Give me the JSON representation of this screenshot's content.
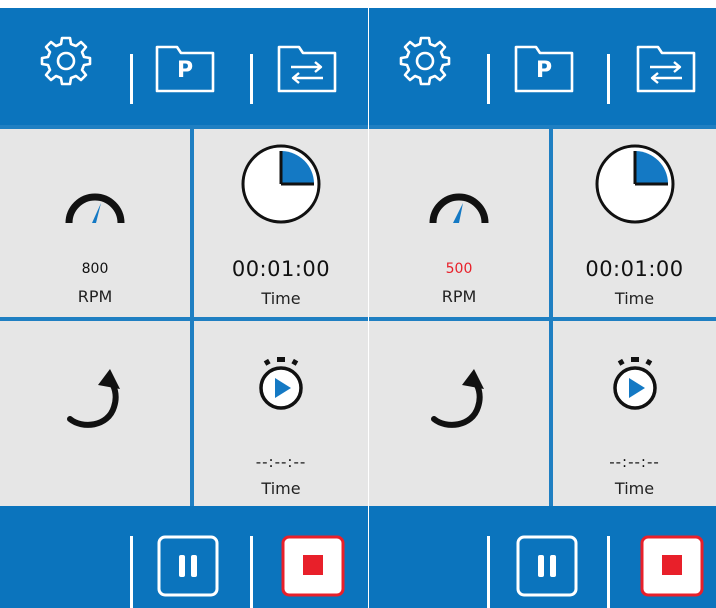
{
  "colors": {
    "header_blue": "#0b74bd",
    "grid_line": "#1f7fc2",
    "cell_bg": "#e6e6e6",
    "icon_blue": "#1479c4",
    "stop_red": "#e8202a",
    "alert_red": "#e8202a"
  },
  "screens": [
    {
      "header": {
        "icons": [
          "gear-icon",
          "folder-p-icon",
          "folder-transfer-icon"
        ],
        "folder_letter": "P"
      },
      "speed": {
        "value": "800",
        "unit": "RPM",
        "highlight": false
      },
      "timer": {
        "value": "00:01:00",
        "label": "Time"
      },
      "direction": {
        "icon": "rotate-clockwise-icon"
      },
      "countdown": {
        "value": "--:--:--",
        "label": "Time"
      },
      "footer": {
        "icons": [
          "pause-icon",
          "stop-icon"
        ]
      }
    },
    {
      "header": {
        "icons": [
          "gear-icon",
          "folder-p-icon",
          "folder-transfer-icon"
        ],
        "folder_letter": "P"
      },
      "speed": {
        "value": "500",
        "unit": "RPM",
        "highlight": true
      },
      "timer": {
        "value": "00:01:00",
        "label": "Time"
      },
      "direction": {
        "icon": "rotate-clockwise-icon"
      },
      "countdown": {
        "value": "--:--:--",
        "label": "Time"
      },
      "footer": {
        "icons": [
          "pause-icon",
          "stop-icon"
        ]
      }
    }
  ]
}
